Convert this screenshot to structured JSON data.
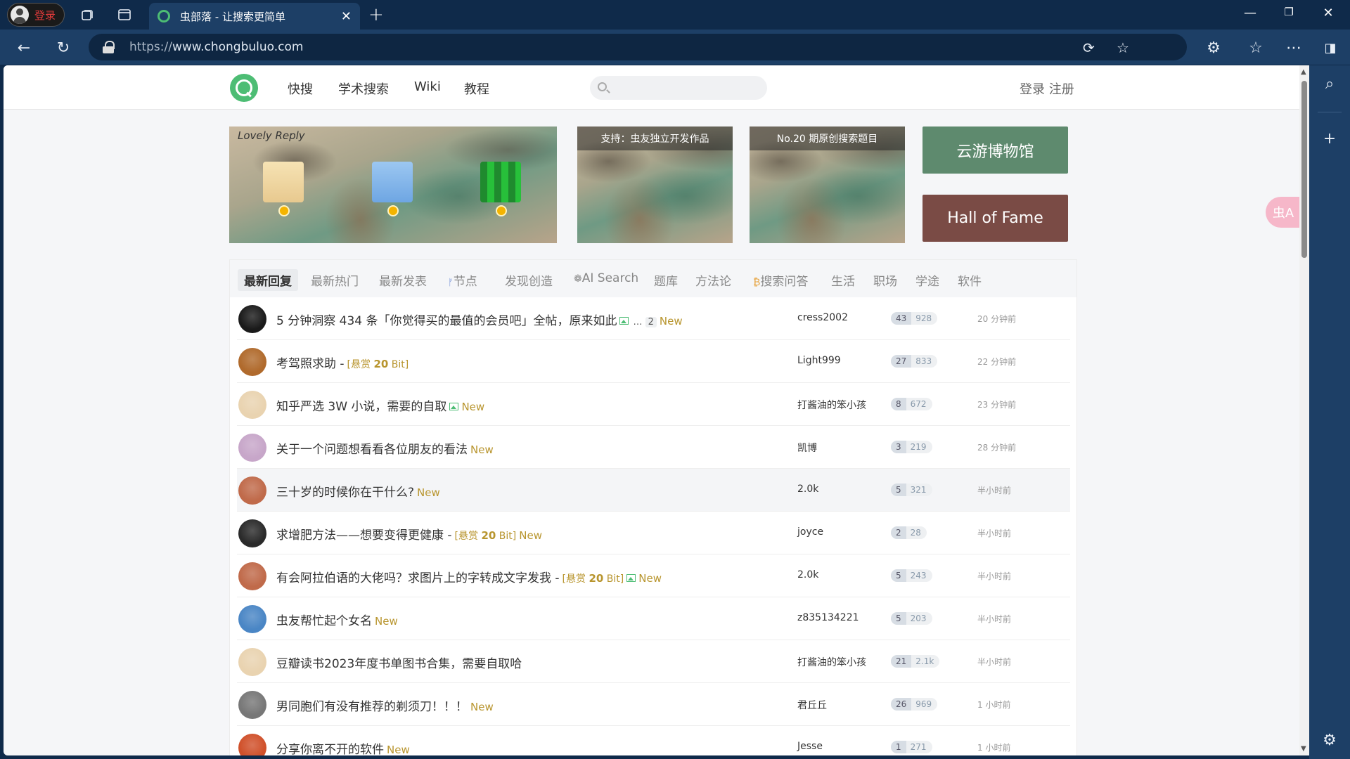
{
  "browser": {
    "profile_label": "登录",
    "tab_title": "虫部落 - 让搜索更简单",
    "url_prefix": "https://",
    "url_domain": "www.chongbuluo.com"
  },
  "site": {
    "menu": [
      "快搜",
      "学术搜索",
      "Wiki",
      "教程"
    ],
    "auth": "登录 注册",
    "search_placeholder": ""
  },
  "banners": {
    "lovely_reply": "Lovely Reply",
    "support_caption": "支持：虫友独立开发作品",
    "no20_caption": "No.20 期原创搜索题目",
    "museum": "云游博物馆",
    "hall_of_fame": "Hall of Fame"
  },
  "tabs": [
    "最新回复",
    "最新热门",
    "最新发表",
    "节点",
    "发现创造",
    "AI Search",
    "题库",
    "方法论",
    "搜索问答",
    "生活",
    "职场",
    "学途",
    "软件"
  ],
  "topics": [
    {
      "title": "5 分钟洞察 434 条「你觉得买的最值的会员吧」全帖，原来如此",
      "img": true,
      "pages": "2",
      "new": "New",
      "user": "cress2002",
      "replies": "43",
      "views": "928",
      "time": "20 分钟前",
      "avatar": "#1a1a1a"
    },
    {
      "title": "考驾照求助 -",
      "reward": "[悬赏 ",
      "reward_num": "20",
      "reward_unit": " Bit]",
      "user": "Light999",
      "replies": "27",
      "views": "833",
      "time": "22 分钟前",
      "avatar": "#b06a2c"
    },
    {
      "title": "知乎严选 3W 小说，需要的自取",
      "img": true,
      "new": "New",
      "user": "打酱油的笨小孩",
      "replies": "8",
      "views": "672",
      "time": "23 分钟前",
      "avatar": "#e9d3b0"
    },
    {
      "title": "关于一个问题想看看各位朋友的看法",
      "new": "New",
      "user": "凯博",
      "replies": "3",
      "views": "219",
      "time": "28 分钟前",
      "avatar": "#c7a6c9"
    },
    {
      "title": "三十岁的时候你在干什么?",
      "new": "New",
      "user": "2.0k",
      "replies": "5",
      "views": "321",
      "time": "半小时前",
      "avatar": "#c06a4a",
      "highlight": true
    },
    {
      "title": "求增肥方法——想要变得更健康 -",
      "reward": "[悬赏 ",
      "reward_num": "20",
      "reward_unit": " Bit]",
      "new": "New",
      "user": "joyce",
      "replies": "2",
      "views": "28",
      "time": "半小时前",
      "avatar": "#2a2a2a"
    },
    {
      "title": "有会阿拉伯语的大佬吗？求图片上的字转成文字发我 -",
      "reward": "[悬赏 ",
      "reward_num": "20",
      "reward_unit": " Bit]",
      "img": true,
      "new": "New",
      "user": "2.0k",
      "replies": "5",
      "views": "243",
      "time": "半小时前",
      "avatar": "#c06a4a"
    },
    {
      "title": "虫友帮忙起个女名",
      "new": "New",
      "user": "z835134221",
      "replies": "5",
      "views": "203",
      "time": "半小时前",
      "avatar": "#4a86c5"
    },
    {
      "title": "豆瓣读书2023年度书单图书合集，需要自取哈",
      "user": "打酱油的笨小孩",
      "replies": "21",
      "views": "2.1k",
      "time": "半小时前",
      "avatar": "#e9d3b0"
    },
    {
      "title": "男同胞们有没有推荐的剃须刀！！！",
      "new": "New",
      "user": "君丘丘",
      "replies": "26",
      "views": "969",
      "time": "1 小时前",
      "avatar": "#777777"
    },
    {
      "title": "分享你离不开的软件",
      "new": "New",
      "user": "Jesse",
      "replies": "1",
      "views": "271",
      "time": "1 小时前",
      "avatar": "#d0502a"
    }
  ],
  "colors": {
    "accent": "#4dbd74",
    "reward": "#b8952e",
    "museum": "#5e8a6e",
    "hall_of_fame": "#7a4b45"
  }
}
